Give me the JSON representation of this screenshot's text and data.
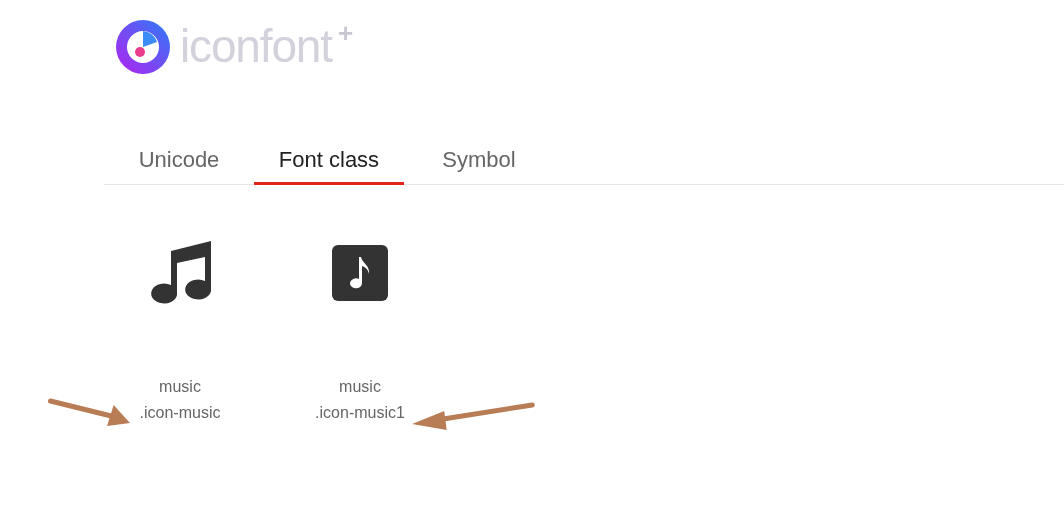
{
  "logo": {
    "text": "iconfont",
    "mark": "+"
  },
  "tabs": [
    {
      "label": "Unicode",
      "selected": false
    },
    {
      "label": "Font class",
      "selected": true
    },
    {
      "label": "Symbol",
      "selected": false
    }
  ],
  "icons": [
    {
      "kind": "notes",
      "name": "music",
      "class_name": ".icon-music"
    },
    {
      "kind": "note-square",
      "name": "music",
      "class_name": ".icon-music1"
    }
  ],
  "annotations": [
    {
      "kind": "arrow-pointing-right"
    },
    {
      "kind": "arrow-pointing-left"
    }
  ]
}
